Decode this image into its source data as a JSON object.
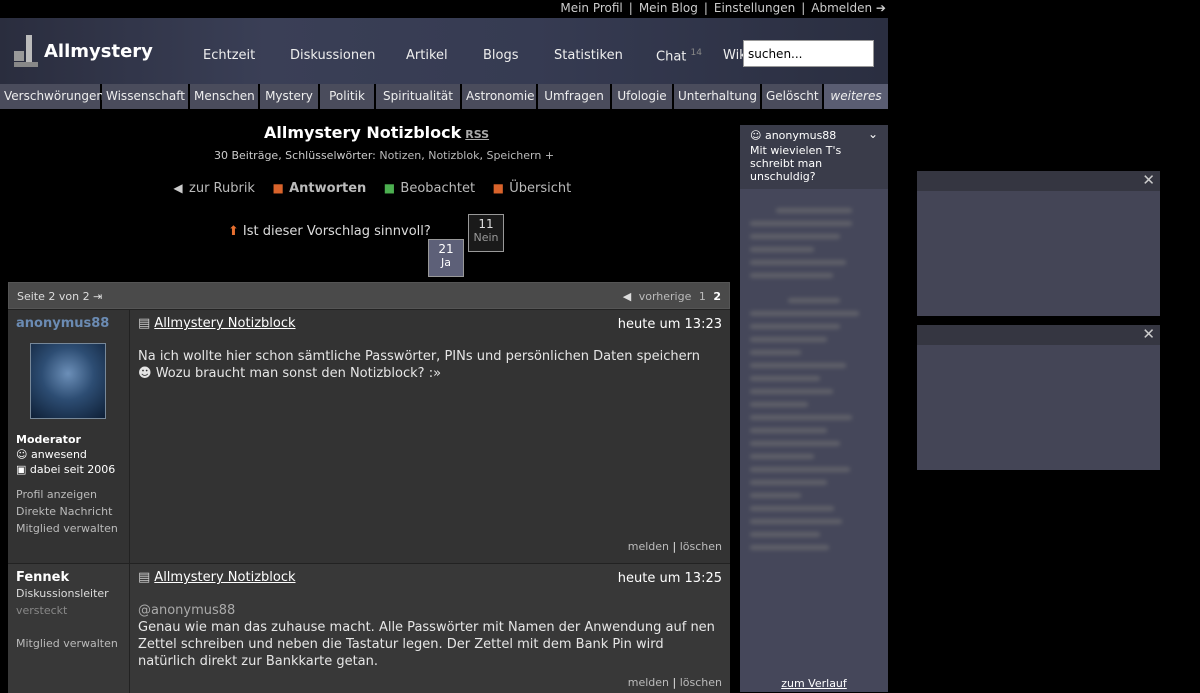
{
  "topbar": {
    "links": [
      "Mein Profil",
      "Mein Blog",
      "Einstellungen",
      "Abmelden ➔"
    ]
  },
  "header": {
    "logo": "Allmystery",
    "nav": [
      "Echtzeit",
      "Diskussionen",
      "Artikel",
      "Blogs",
      "Statistiken",
      "Chat",
      "Wik"
    ],
    "chat_count": "14",
    "search_placeholder": "suchen..."
  },
  "categories": [
    "Verschwörungen",
    "Wissenschaft",
    "Menschen",
    "Mystery",
    "Politik",
    "Spiritualität",
    "Astronomie",
    "Umfragen",
    "Ufologie",
    "Unterhaltung",
    "Gelöscht",
    "weiteres"
  ],
  "thread": {
    "title": "Allmystery Notizblock",
    "rss": "RSS",
    "meta_prefix": "30 Beiträge, Schlüsselwörter:",
    "keywords": [
      "Notizen",
      "Notizblok",
      "Speichern"
    ],
    "keyword_add": "+",
    "actions": [
      "zur Rubrik",
      "Antworten",
      "Beobachtet",
      "Übersicht"
    ],
    "poll_question": "Ist dieser Vorschlag sinnvoll?",
    "yes_count": "21",
    "yes_label": "Ja",
    "no_count": "11",
    "no_label": "Nein"
  },
  "pager": {
    "label": "Seite 2 von 2",
    "prev": "vorherige",
    "page1": "1",
    "page2": "2"
  },
  "posts": [
    {
      "author": "anonymus88",
      "role": "Moderator",
      "status": "anwesend",
      "since": "dabei seit 2006",
      "links": [
        "Profil anzeigen",
        "Direkte Nachricht",
        "Mitglied verwalten"
      ],
      "title": "Allmystery Notizblock",
      "time": "heute um 13:23",
      "text1": "Na ich wollte hier schon sämtliche Passwörter, PINs und persönlichen Daten speichern",
      "text2": "Wozu braucht man sonst den Notizblock? :»",
      "report": "melden",
      "delete": "löschen"
    },
    {
      "author": "Fennek",
      "role": "Diskussionsleiter",
      "status": "versteckt",
      "links": [
        "Mitglied verwalten"
      ],
      "title": "Allmystery Notizblock",
      "time": "heute um 13:25",
      "mention": "@anonymus88",
      "text": "Genau wie man das zuhause macht. Alle Passwörter mit Namen der Anwendung auf nen Zettel schreiben und neben die Tastatur legen. Der Zettel mit dem Bank Pin wird natürlich direkt zur Bankkarte getan.",
      "report": "melden",
      "delete": "löschen"
    }
  ],
  "sidebar": {
    "user": "anonymus88",
    "question": "Mit wievielen T's schreibt man unschuldig?",
    "history_link": "zum Verlauf"
  },
  "widgets": {
    "close": "✕"
  }
}
